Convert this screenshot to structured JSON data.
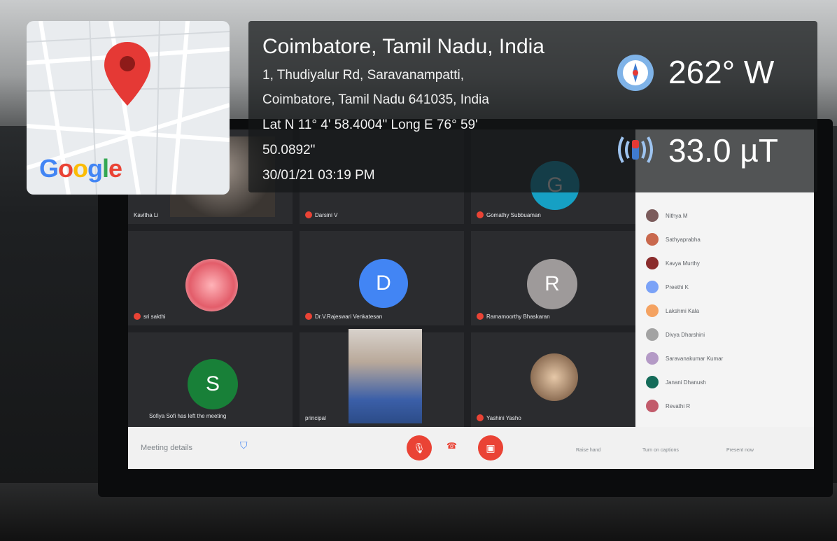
{
  "geotag": {
    "location_title": "Coimbatore, Tamil Nadu, India",
    "address_lines": [
      "1, Thudiyalur Rd, Saravanampatti,",
      "Coimbatore, Tamil Nadu 641035, India",
      "Lat N 11° 4' 58.4004\" Long E 76° 59'",
      "50.0892\"",
      "30/01/21 03:19 PM"
    ],
    "map_logo": "Google",
    "compass_heading": "262° W",
    "magnetic_field": "33.0 µT"
  },
  "meeting": {
    "tiles": [
      {
        "name": "Kavitha Li",
        "letter": "",
        "color": "#6d6e70"
      },
      {
        "name": "Darsini V",
        "letter": "",
        "color": "#2b2c2f"
      },
      {
        "name": "Gomathy Subbuaman",
        "letter": "G",
        "color": "#16a0c4"
      },
      {
        "name": "sri sakthi",
        "letter": "",
        "color": "#f28b82"
      },
      {
        "name": "Dr.V.Rajeswari Venkatesan",
        "letter": "D",
        "color": "#4285f4"
      },
      {
        "name": "Ramamoorthy Bhaskaran",
        "letter": "R",
        "color": "#9e9a9a"
      },
      {
        "name": "",
        "letter": "S",
        "color": "#188038"
      },
      {
        "name": "principal",
        "letter": "",
        "color": "#8a8a8a"
      },
      {
        "name": "Yashini Yasho",
        "letter": "",
        "color": "#c8b9a8"
      }
    ],
    "left_notice": "Sofiya Sofi has left the meeting",
    "controls": {
      "meeting_details": "Meeting details",
      "raise_hand": "Raise hand",
      "captions": "Turn on captions",
      "present": "Present now"
    },
    "participants": [
      {
        "name": "Nithya M",
        "initial": "N",
        "color": "#7b5b5b"
      },
      {
        "name": "Sathyaprabha",
        "initial": "",
        "color": "#c9684d"
      },
      {
        "name": "Kavya Murthy",
        "initial": "",
        "color": "#8a2c2c"
      },
      {
        "name": "Preethi K",
        "initial": "P",
        "color": "#7aa2f7"
      },
      {
        "name": "Lakshmi Kala",
        "initial": "",
        "color": "#f4a261"
      },
      {
        "name": "Divya Dharshini",
        "initial": "",
        "color": "#a3a3a3"
      },
      {
        "name": "Saravanakumar Kumar",
        "initial": "",
        "color": "#b49ac6"
      },
      {
        "name": "Janani Dhanush",
        "initial": "",
        "color": "#146b59"
      },
      {
        "name": "Revathi R",
        "initial": "",
        "color": "#c25b6b"
      }
    ]
  },
  "colors": {
    "pin": "#e53935",
    "hangup": "#ea4335"
  }
}
